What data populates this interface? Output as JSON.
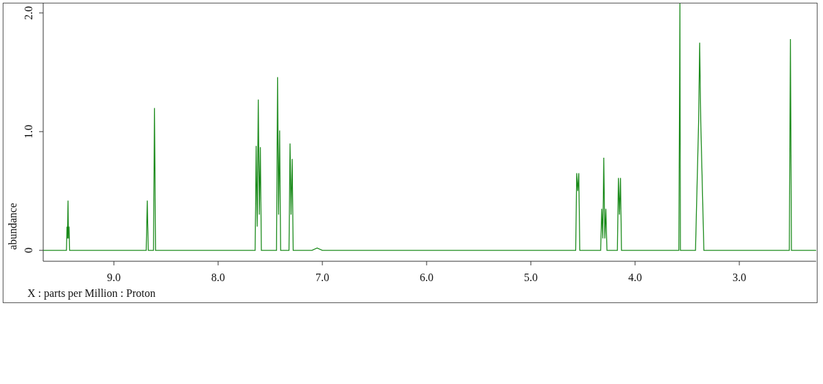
{
  "spectrum_plot": {
    "chart_data": {
      "type": "line",
      "xlabel": "X : parts per Million : Proton",
      "ylabel": "abundance",
      "xlim": [
        9.678,
        2.263
      ],
      "ylim": [
        -0.092,
        2.086
      ],
      "xticks": [
        {
          "value": 9,
          "label": "9.0"
        },
        {
          "value": 8,
          "label": "8.0"
        },
        {
          "value": 7,
          "label": "7.0"
        },
        {
          "value": 6,
          "label": "6.0"
        },
        {
          "value": 5,
          "label": "5.0"
        },
        {
          "value": 4,
          "label": "4.0"
        },
        {
          "value": 3,
          "label": "3.0"
        }
      ],
      "yticks": [
        {
          "value": 0,
          "label": "0"
        },
        {
          "value": 1,
          "label": "1.0"
        },
        {
          "value": 2,
          "label": "2.0"
        }
      ],
      "x": [
        9.678,
        9.455,
        9.45,
        9.445,
        9.44,
        9.435,
        9.43,
        9.425,
        8.69,
        8.68,
        8.67,
        8.62,
        8.61,
        8.6,
        7.645,
        7.635,
        7.625,
        7.615,
        7.605,
        7.595,
        7.585,
        7.44,
        7.43,
        7.42,
        7.41,
        7.4,
        7.32,
        7.31,
        7.3,
        7.29,
        7.28,
        7.1,
        7.05,
        7.0,
        4.57,
        4.56,
        4.55,
        4.54,
        4.53,
        4.33,
        4.32,
        4.31,
        4.3,
        4.29,
        4.28,
        4.27,
        4.17,
        4.16,
        4.15,
        4.14,
        4.13,
        3.58,
        3.57,
        3.565,
        3.42,
        3.39,
        3.38,
        3.37,
        3.34,
        2.52,
        2.51,
        2.5,
        2.263
      ],
      "series": [
        {
          "color": "#1a8a1a",
          "values": [
            0,
            0,
            0.2,
            0.1,
            0.42,
            0.1,
            0.2,
            0,
            0,
            0.42,
            0,
            0,
            1.2,
            0,
            0,
            0.88,
            0.2,
            1.27,
            0.3,
            0.87,
            0,
            0,
            1.46,
            0.3,
            1.01,
            0,
            0,
            0.9,
            0.3,
            0.77,
            0,
            0,
            0.02,
            0,
            0,
            0.65,
            0.5,
            0.65,
            0,
            0,
            0.35,
            0.1,
            0.78,
            0.1,
            0.35,
            0,
            0,
            0.61,
            0.3,
            0.61,
            0,
            0,
            2.08,
            0,
            0,
            1.1,
            1.75,
            1.1,
            0,
            0,
            1.78,
            0,
            0
          ]
        }
      ]
    }
  }
}
